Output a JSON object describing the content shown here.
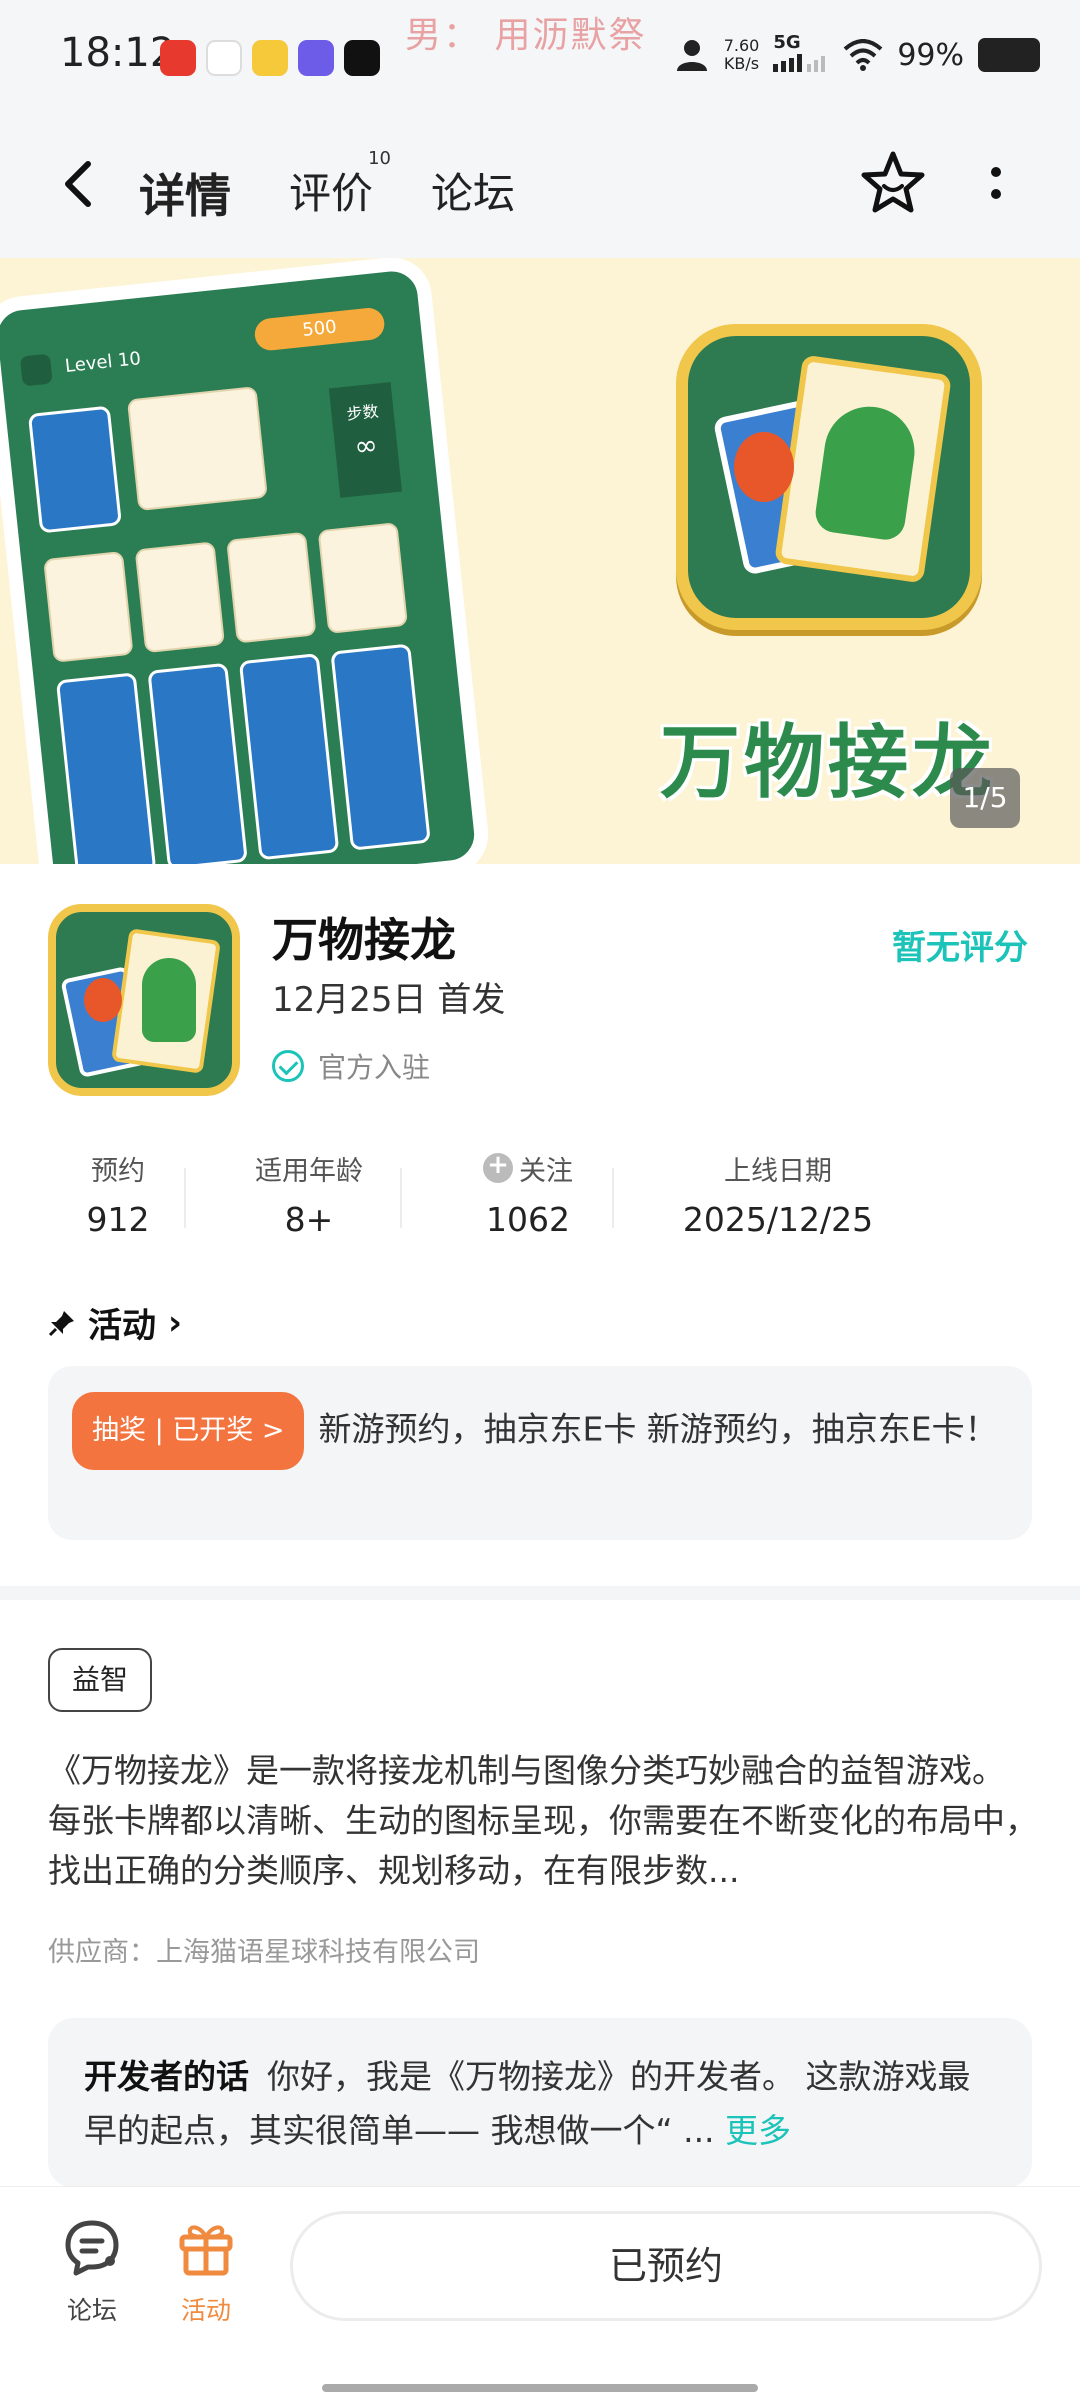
{
  "status_bar": {
    "time": "18:12",
    "center_text": "男： 用沥默祭",
    "speed": "7.60",
    "speed_unit": "KB/s",
    "network": "5G",
    "battery_percent": "99%",
    "app_icons": [
      {
        "name": "netease-music-icon",
        "color": "#e8392f"
      },
      {
        "name": "hourglass-app-icon",
        "color": "#ffffff"
      },
      {
        "name": "yellow-app-icon",
        "color": "#f6c93b"
      },
      {
        "name": "purple-app-icon",
        "color": "#6c5ce7"
      },
      {
        "name": "music-app-icon",
        "color": "#111111"
      }
    ]
  },
  "header": {
    "tabs": [
      {
        "label": "详情",
        "active": true
      },
      {
        "label": "评价",
        "badge": "10"
      },
      {
        "label": "论坛"
      }
    ]
  },
  "banner": {
    "title": "万物接龙",
    "pager": "1/5",
    "phone": {
      "level": "Level 10",
      "coins": "500",
      "steps_label": "步数",
      "steps_value": "∞"
    }
  },
  "app": {
    "name": "万物接龙",
    "date": "12月25日  首发",
    "official": "官方入驻",
    "rating": "暂无评分"
  },
  "stats": [
    {
      "label": "预约",
      "value": "912"
    },
    {
      "label": "适用年龄",
      "value": "8+"
    },
    {
      "label": "关注",
      "value": "1062"
    },
    {
      "label": "上线日期",
      "value": "2025/12/25"
    }
  ],
  "activity": {
    "title": "活动",
    "badge": "抽奖 | 已开奖 >",
    "text": "新游预约，抽京东E卡 新游预约，抽京东E卡！"
  },
  "tag": "益智",
  "description": "《万物接龙》是一款将接龙机制与图像分类巧妙融合的益智游戏。 每张卡牌都以清晰、生动的图标呈现，你需要在不断变化的布局中，找出正确的分类顺序、规划移动，在有限步数...",
  "supplier": "供应商：上海猫语星球科技有限公司",
  "developer": {
    "label": "开发者的话",
    "text": "你好，我是《万物接龙》的开发者。 这款游戏最早的起点，其实很简单—— 我想做一个“ ...",
    "more": "更多"
  },
  "bottom_nav": {
    "forum": "论坛",
    "activity": "活动",
    "reserve_button": "已预约"
  },
  "colors": {
    "accent": "#1cc3b8",
    "tab_highlight": "#1dd0c4",
    "activity_orange": "#f47440",
    "banner_bg": "#fdf4d6",
    "game_green": "#2e7b52"
  }
}
